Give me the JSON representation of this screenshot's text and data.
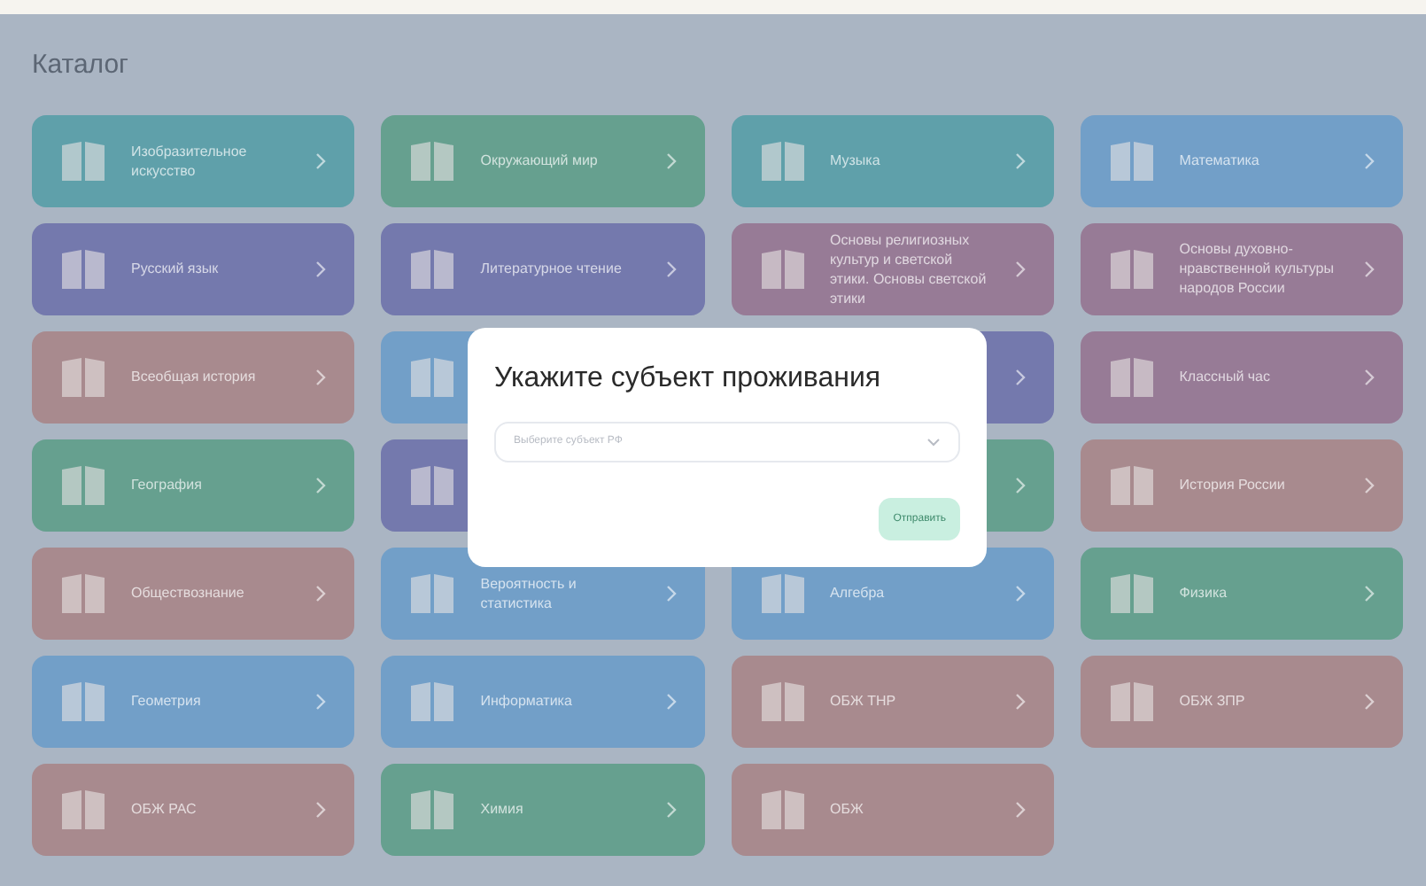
{
  "page": {
    "title": "Каталог"
  },
  "cards": [
    {
      "label": "Изобразительное искусство",
      "color": "#5fa0aa"
    },
    {
      "label": "Окружающий мир",
      "color": "#66a08f"
    },
    {
      "label": "Музыка",
      "color": "#5fa0aa"
    },
    {
      "label": "Математика",
      "color": "#729fc8"
    },
    {
      "label": "Русский язык",
      "color": "#7479ad"
    },
    {
      "label": "Литературное чтение",
      "color": "#7479ad"
    },
    {
      "label": "Основы религиозных культур и светской этики. Основы светской этики",
      "color": "#977b96"
    },
    {
      "label": "Основы духовно-нравственной культуры народов России",
      "color": "#977b96"
    },
    {
      "label": "Всеобщая история",
      "color": "#a88a8e"
    },
    {
      "color": "#729fc8"
    },
    {
      "color": "#7479ad"
    },
    {
      "label": "Классный час",
      "color": "#977b96"
    },
    {
      "label": "География",
      "color": "#66a08f"
    },
    {
      "color": "#7479ad"
    },
    {
      "color": "#66a08f"
    },
    {
      "label": "История России",
      "color": "#a88a8e"
    },
    {
      "label": "Обществознание",
      "color": "#a88a8e"
    },
    {
      "label": "Вероятность и статистика",
      "color": "#729fc8"
    },
    {
      "label": "Алгебра",
      "color": "#729fc8"
    },
    {
      "label": "Физика",
      "color": "#66a08f"
    },
    {
      "label": "Геометрия",
      "color": "#729fc8"
    },
    {
      "label": "Информатика",
      "color": "#729fc8"
    },
    {
      "label": "ОБЖ ТНР",
      "color": "#a88a8e"
    },
    {
      "label": "ОБЖ ЗПР",
      "color": "#a88a8e"
    },
    {
      "label": "ОБЖ РАС",
      "color": "#a88a8e"
    },
    {
      "label": "Химия",
      "color": "#66a08f"
    },
    {
      "label": "ОБЖ",
      "color": "#a88a8e"
    }
  ],
  "dialog": {
    "title": "Укажите субъект проживания",
    "select": {
      "placeholder": "Выберите субъект РФ"
    },
    "submit": {
      "label": "Отправить",
      "disabled": true
    }
  }
}
